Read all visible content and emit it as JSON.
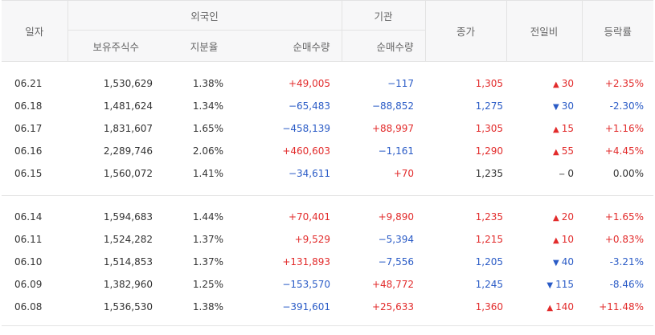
{
  "header": {
    "date": "일자",
    "foreign_group": "외국인",
    "institution_group": "기관",
    "holdings": "보유주식수",
    "ratio": "지분율",
    "foreign_net": "순매수량",
    "institution_net": "순매수량",
    "close": "종가",
    "change": "전일비",
    "rate": "등락률"
  },
  "colors": {
    "up": "#e22b2b",
    "down": "#2a5bc6",
    "flat": "#333333"
  },
  "rows": [
    {
      "date": "06.21",
      "holdings": "1,530,629",
      "ratio": "1.38%",
      "foreign_net": "+49,005",
      "institution_net": "−117",
      "close": "1,305",
      "change": "30",
      "direction": "up",
      "arrow": "▲",
      "rate": "+2.35%"
    },
    {
      "date": "06.18",
      "holdings": "1,481,624",
      "ratio": "1.34%",
      "foreign_net": "−65,483",
      "institution_net": "−88,852",
      "close": "1,275",
      "change": "30",
      "direction": "down",
      "arrow": "▼",
      "rate": "-2.30%"
    },
    {
      "date": "06.17",
      "holdings": "1,831,607",
      "ratio": "1.65%",
      "foreign_net": "−458,139",
      "institution_net": "+88,997",
      "close": "1,305",
      "change": "15",
      "direction": "up",
      "arrow": "▲",
      "rate": "+1.16%"
    },
    {
      "date": "06.16",
      "holdings": "2,289,746",
      "ratio": "2.06%",
      "foreign_net": "+460,603",
      "institution_net": "−1,161",
      "close": "1,290",
      "change": "55",
      "direction": "up",
      "arrow": "▲",
      "rate": "+4.45%"
    },
    {
      "date": "06.15",
      "holdings": "1,560,072",
      "ratio": "1.41%",
      "foreign_net": "−34,611",
      "institution_net": "+70",
      "close": "1,235",
      "change": "0",
      "direction": "flat",
      "arrow": "−",
      "rate": "0.00%"
    },
    {
      "date": "06.14",
      "holdings": "1,594,683",
      "ratio": "1.44%",
      "foreign_net": "+70,401",
      "institution_net": "+9,890",
      "close": "1,235",
      "change": "20",
      "direction": "up",
      "arrow": "▲",
      "rate": "+1.65%"
    },
    {
      "date": "06.11",
      "holdings": "1,524,282",
      "ratio": "1.37%",
      "foreign_net": "+9,529",
      "institution_net": "−5,394",
      "close": "1,215",
      "change": "10",
      "direction": "up",
      "arrow": "▲",
      "rate": "+0.83%"
    },
    {
      "date": "06.10",
      "holdings": "1,514,853",
      "ratio": "1.37%",
      "foreign_net": "+131,893",
      "institution_net": "−7,556",
      "close": "1,205",
      "change": "40",
      "direction": "down",
      "arrow": "▼",
      "rate": "-3.21%"
    },
    {
      "date": "06.09",
      "holdings": "1,382,960",
      "ratio": "1.25%",
      "foreign_net": "−153,570",
      "institution_net": "+48,772",
      "close": "1,245",
      "change": "115",
      "direction": "down",
      "arrow": "▼",
      "rate": "-8.46%"
    },
    {
      "date": "06.08",
      "holdings": "1,536,530",
      "ratio": "1.38%",
      "foreign_net": "−391,601",
      "institution_net": "+25,633",
      "close": "1,360",
      "change": "140",
      "direction": "up",
      "arrow": "▲",
      "rate": "+11.48%"
    }
  ]
}
